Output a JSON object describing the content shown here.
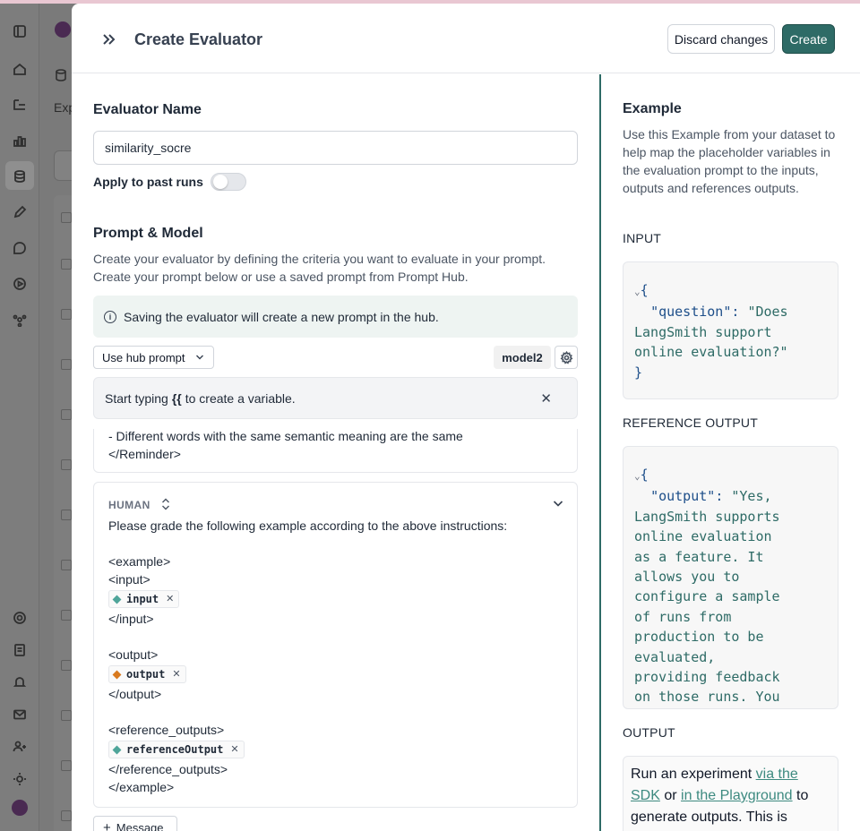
{
  "background": {
    "list_label": "Exp"
  },
  "modal": {
    "title": "Create Evaluator",
    "discard_label": "Discard changes",
    "create_label": "Create"
  },
  "form": {
    "name_heading": "Evaluator Name",
    "name_value": "similarity_socre",
    "apply_label": "Apply to past runs",
    "apply_enabled": false,
    "prompt_heading": "Prompt & Model",
    "prompt_desc": "Create your evaluator by defining the criteria you want to evaluate in your prompt. Create your prompt below or use a saved prompt from Prompt Hub.",
    "info_text": "Saving the evaluator will create a new prompt in the hub.",
    "hub_select_label": "Use hub prompt",
    "model_label": "model2",
    "var_hint_before": "Start typing",
    "var_hint_braces": "{{",
    "var_hint_after": "to create a variable.",
    "system_tail_1": "- Different words with the same semantic meaning are the same",
    "system_tail_2": "</Reminder>",
    "human_role": "HUMAN",
    "human_lines": {
      "l1": "Please grade the following example according to the above instructions:",
      "l2": "<example>",
      "l3": "<input>",
      "chip_input": "input",
      "l4": "</input>",
      "l5": "<output>",
      "chip_output": "output",
      "l6": "</output>",
      "l7": "<reference_outputs>",
      "chip_reference": "referenceOutput",
      "l8": "</reference_outputs>",
      "l9": "</example>"
    },
    "add_message_label": "Message"
  },
  "example": {
    "title": "Example",
    "desc": "Use this Example from your dataset to help map the placeholder variables in the evaluation prompt to the inputs, outputs and references outputs.",
    "input_label": "INPUT",
    "input_json": {
      "key": "\"question\"",
      "l1": "\"Does",
      "l2": "LangSmith support",
      "l3": "online evaluation?\""
    },
    "reference_label": "REFERENCE OUTPUT",
    "reference_json": {
      "key": "\"output\"",
      "l1": "\"Yes,",
      "l2": "LangSmith supports",
      "l3": "online evaluation",
      "l4": "as a feature. It",
      "l5": "allows you to",
      "l6": "configure a sample",
      "l7": "of runs from",
      "l8": "production to be",
      "l9": "evaluated,",
      "l10": "providing feedback",
      "l11": "on those runs. You"
    },
    "output_label": "OUTPUT",
    "output_text": {
      "a": "Run an experiment",
      "link1": "via the SDK",
      "b": "or",
      "link2": "in the Playground",
      "c": "to generate outputs. This is"
    }
  },
  "colors": {
    "accent": "#2e6b66",
    "chip_input": "#4fa59a",
    "chip_output": "#d97a1e",
    "chip_reference": "#4fa59a"
  }
}
